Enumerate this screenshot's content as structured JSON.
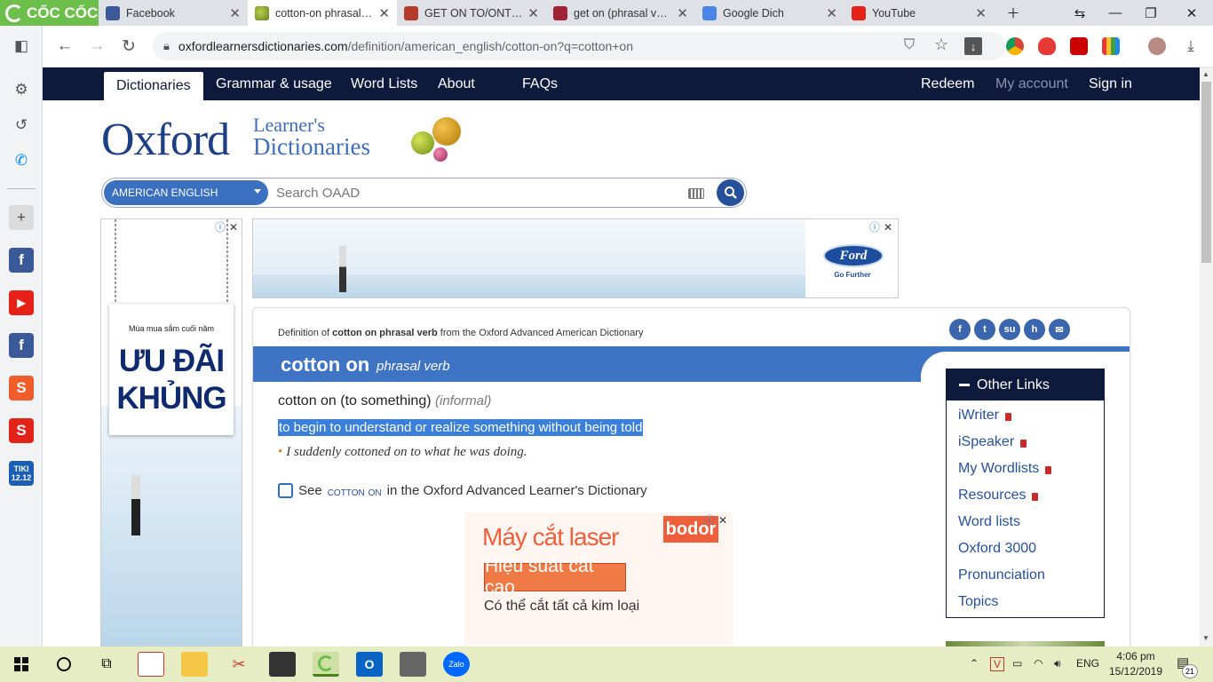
{
  "browser": {
    "brand": "CỐC CỐC",
    "tabs": [
      {
        "title": "Facebook",
        "active": false
      },
      {
        "title": "cotton-on phrasal verb",
        "active": true
      },
      {
        "title": "GET ON TO/ONTO ST",
        "active": false
      },
      {
        "title": "get on (phrasal verb)",
        "active": false
      },
      {
        "title": "Google Dich",
        "active": false
      },
      {
        "title": "YouTube",
        "active": false
      }
    ],
    "address": {
      "domain": "oxfordlearnersdictionaries.com",
      "path": "/definition/american_english/cotton-on?q=cotton+on"
    }
  },
  "site": {
    "nav_left": [
      "Dictionaries",
      "Grammar & usage",
      "Word Lists",
      "About",
      "FAQs"
    ],
    "nav_right": [
      "Redeem",
      "My account",
      "Sign in"
    ],
    "logo_main": "Oxford",
    "logo_sub1": "Learner's",
    "logo_sub2": "Dictionaries",
    "search": {
      "dictionary": "AMERICAN ENGLISH",
      "placeholder": "Search OAAD"
    }
  },
  "ads": {
    "left_small": "Mùa mua sắm cuối năm",
    "left_big": "ƯU ĐÃI KHỦNG",
    "ford_logo": "Ford",
    "ford_tagline": "Go Further",
    "laser_title": "Máy cắt laser",
    "laser_sub": "Hiệu suất cắt cao",
    "laser_line": "Có thể cắt tất cả kim loại",
    "laser_brand": "bodor"
  },
  "entry": {
    "source_prefix": "Definition of",
    "source_term": "cotton on phrasal verb",
    "source_suffix": "from the Oxford Advanced American Dictionary",
    "headword": "cotton on",
    "pos": "phrasal verb",
    "sense": "cotton on (to something)",
    "label": "(informal)",
    "definition": "to begin to understand or realize something without being told",
    "example": "I suddenly cottoned on to what he was doing.",
    "see_prefix": "See",
    "see_term": "cotton on",
    "see_suffix": "in the Oxford Advanced Learner's Dictionary"
  },
  "other_links": {
    "title": "Other Links",
    "items": [
      {
        "label": "iWriter",
        "locked": true
      },
      {
        "label": "iSpeaker",
        "locked": true
      },
      {
        "label": "My Wordlists",
        "locked": true
      },
      {
        "label": "Resources",
        "locked": true
      },
      {
        "label": "Word lists",
        "locked": false
      },
      {
        "label": "Oxford 3000",
        "locked": false
      },
      {
        "label": "Pronunciation",
        "locked": false
      },
      {
        "label": "Topics",
        "locked": false
      }
    ]
  },
  "taskbar": {
    "lang": "ENG",
    "time": "4:06 pm",
    "date": "15/12/2019",
    "notif_count": "21"
  },
  "colors": {
    "navy": "#0e1a3c",
    "oxford_blue": "#3f74c4",
    "selection": "#3a7fd9",
    "coccoc_green": "#6cbf4a"
  }
}
